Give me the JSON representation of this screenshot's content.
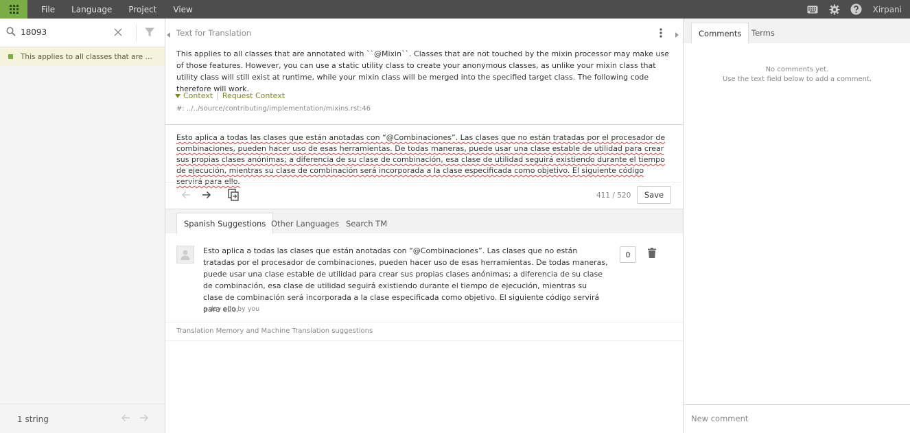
{
  "menu": [
    "File",
    "Language",
    "Project",
    "View"
  ],
  "user": {
    "name": "Xirpani"
  },
  "search": {
    "value": "18093"
  },
  "unit": {
    "text": "This applies to all classes that are annotated with ``@Mixin``. Classes that are not touched by the mixin processor may make use of those features."
  },
  "footer": {
    "count": "1 string"
  },
  "source": {
    "header": "Text for Translation",
    "text": "This applies to all classes that are annotated with ``@Mixin``. Classes that are not touched by the mixin processor may make use of those features. However, you can use a static utility class to create your anonymous classes, as unlike your mixin class that utility class will still exist at runtime, while your mixin class will be merged into the specified target class. The following code therefore will work.",
    "context_label": "Context",
    "request_context": "Request Context",
    "location": "#: ../../source/contributing/implementation/mixins.rst:46"
  },
  "target": {
    "text": "Esto aplica a todas las clases que están anotadas con “@Combinaciones”. Las clases que no están tratadas por el procesador de combinaciones, pueden hacer uso de esas herramientas. De todas maneras, puede usar una clase estable de utilidad para crear sus propias clases anónimas; a diferencia de su clase de combinación, esa clase de utilidad seguirá existiendo durante el tiempo de ejecución, mientras su clase de combinación será incorporada a la clase especificada como objetivo. El siguiente código servirá para ello.",
    "count": "411 / 520",
    "save": "Save"
  },
  "tabs": [
    "Spanish Suggestions",
    "Other Languages",
    "Search TM"
  ],
  "suggestion": {
    "text": "Esto aplica a todas las clases que están anotadas con “@Combinaciones”. Las clases que no están tratadas por el procesador de combinaciones, pueden hacer uso de esas herramientas. De todas maneras, puede usar una clase estable de utilidad para crear sus propias clases anónimas; a diferencia de su clase de combinación, esa clase de utilidad seguirá existiendo durante el tiempo de ejecución, mientras su clase de combinación será incorporada a la clase especificada como objetivo. El siguiente código servirá para ello.",
    "meta": "a day ago by you",
    "votes": "0"
  },
  "tm_header": "Translation Memory and Machine Translation suggestions",
  "right_tabs": [
    "Comments",
    "Terms"
  ],
  "comments": {
    "empty_line1": "No comments yet.",
    "empty_line2": "Use the text field below to add a comment.",
    "placeholder": "New comment"
  },
  "colors": {
    "accent": "#7bad47",
    "topbar": "#4d4d4d"
  }
}
